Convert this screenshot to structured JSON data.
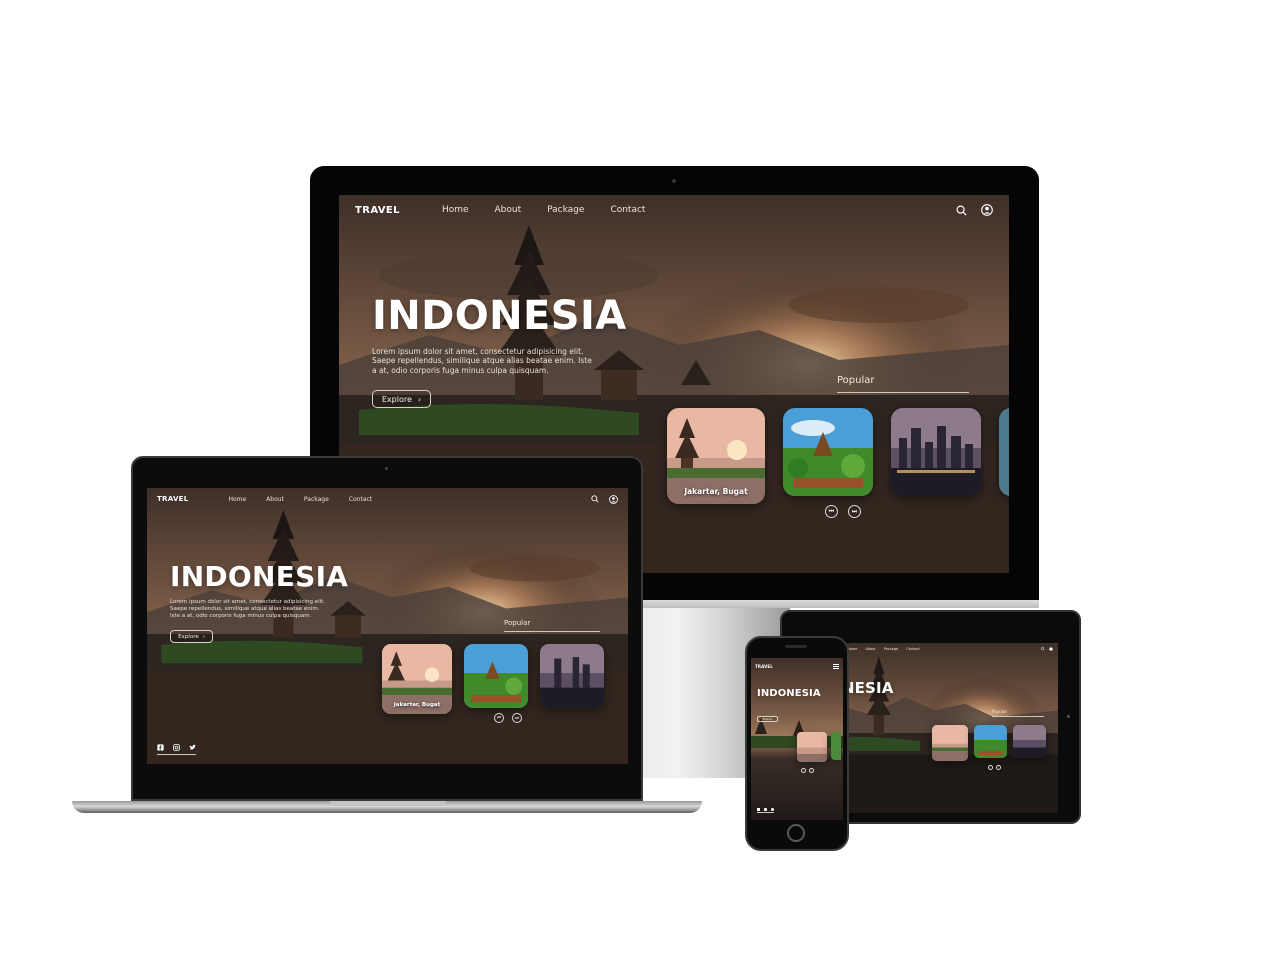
{
  "site": {
    "logo": "TRAVEL",
    "nav": [
      "Home",
      "About",
      "Package",
      "Contact"
    ],
    "hero_title": "INDONESIA",
    "hero_text": "Lorem ipsum dolor sit amet, consectetur adipisicing elit. Saepe repellendus, similique atque alias beatae enim. Iste a at, odio corporis fuga minus culpa quisquam.",
    "explore_label": "Explore",
    "explore_arrow": "›",
    "popular_label": "Popular",
    "cards": [
      {
        "label": "Jakartar, Bugat",
        "scene": "temple-sunset"
      },
      {
        "label": "",
        "scene": "green-temple"
      },
      {
        "label": "",
        "scene": "city-night"
      }
    ],
    "controls": {
      "prev": "⏮",
      "next": "⏭"
    },
    "social": [
      "facebook-icon",
      "instagram-icon",
      "twitter-icon"
    ]
  },
  "colors": {
    "accent_text": "#ffffff",
    "hero_sky_top": "#5a463a",
    "hero_sky_mid": "#8a6a52",
    "sun": "#f6d9a6",
    "water": "#2a2420"
  }
}
